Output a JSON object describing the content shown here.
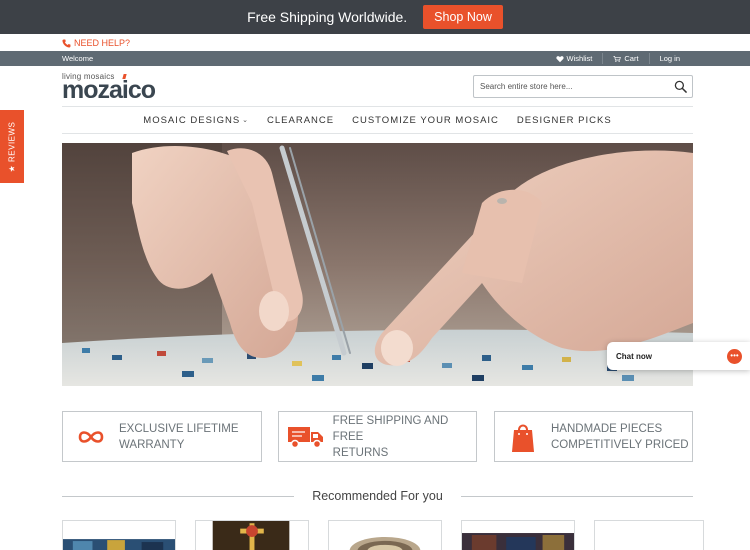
{
  "promo": {
    "text": "Free Shipping Worldwide.",
    "button": "Shop Now"
  },
  "help": {
    "label": "NEED HELP?"
  },
  "account": {
    "welcome": "Welcome",
    "wishlist": "Wishlist",
    "cart": "Cart",
    "login": "Log in"
  },
  "logo": {
    "tagline": "living mosaics",
    "name": "mozaico"
  },
  "search": {
    "placeholder": "Search entire store here..."
  },
  "nav": {
    "items": [
      {
        "label": "MOSAIC DESIGNS",
        "dropdown": true
      },
      {
        "label": "CLEARANCE"
      },
      {
        "label": "CUSTOMIZE YOUR MOSAIC"
      },
      {
        "label": "DESIGNER PICKS"
      }
    ]
  },
  "reviews_tab": {
    "label": "★ REVIEWS"
  },
  "features": [
    {
      "icon": "infinity-icon",
      "line1": "EXCLUSIVE LIFETIME",
      "line2": "WARRANTY"
    },
    {
      "icon": "delivery-truck-icon",
      "line1": "FREE SHIPPING AND FREE",
      "line2": "RETURNS"
    },
    {
      "icon": "shopping-bag-icon",
      "line1": "HANDMADE PIECES",
      "line2": "COMPETITIVELY PRICED"
    }
  ],
  "recommended": {
    "title": "Recommended For you"
  },
  "chat": {
    "label": "Chat now"
  },
  "colors": {
    "accent": "#e9512b",
    "dark_bar": "#3d4147",
    "account_bar": "#5f6a73",
    "logo": "#3a4650"
  }
}
